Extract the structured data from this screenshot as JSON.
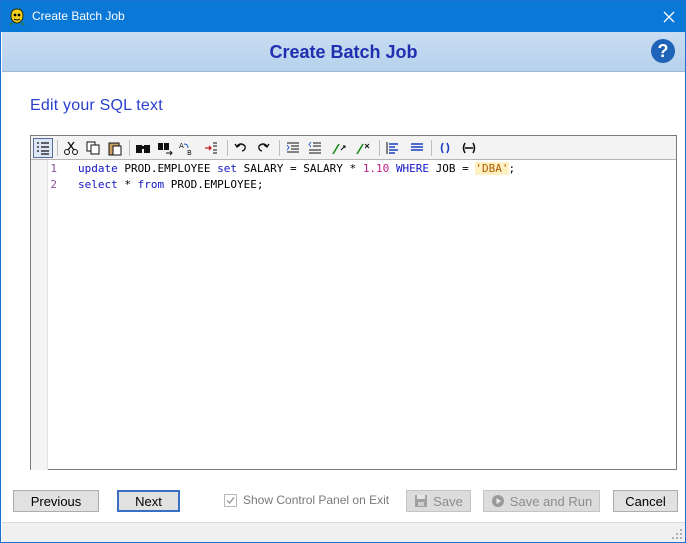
{
  "window": {
    "title": "Create Batch Job",
    "close_label": "✕"
  },
  "header": {
    "title": "Create Batch Job",
    "help_label": "?"
  },
  "subtitle": "Edit your SQL text",
  "toolbar": {
    "buttons": [
      "line-numbers-icon",
      "cut-icon",
      "copy-icon",
      "paste-icon",
      "find-icon",
      "find-next-icon",
      "replace-icon",
      "goto-line-icon",
      "undo-icon",
      "redo-icon",
      "indent-icon",
      "outdent-icon",
      "comment-icon",
      "uncomment-icon",
      "align-left-icon",
      "align-justify-icon",
      "brackets-icon",
      "collapse-icon"
    ]
  },
  "editor": {
    "lines": [
      {
        "number": "1"
      },
      {
        "number": "2"
      }
    ],
    "line1": {
      "kw_update": "update",
      "t1": " PROD.EMPLOYEE ",
      "kw_set": "set",
      "t2": " SALARY = SALARY * ",
      "num": "1.10",
      "t3": " ",
      "kw_where": "WHERE",
      "t4": " JOB = ",
      "str": "'DBA'",
      "t5": ";"
    },
    "line2": {
      "kw_select": "select",
      "t1": " * ",
      "kw_from": "from",
      "t2": " PROD.EMPLOYEE;"
    }
  },
  "footer": {
    "previous_label": "Previous",
    "next_label": "Next",
    "show_panel_label": "Show Control Panel on Exit",
    "show_panel_checked": true,
    "save_label": "Save",
    "save_run_label": "Save and Run",
    "cancel_label": "Cancel"
  },
  "colors": {
    "titlebar": "#0a78d7",
    "heading": "#1f2fb0",
    "subtitle": "#2a3fd0",
    "keyword": "#1414c8"
  }
}
